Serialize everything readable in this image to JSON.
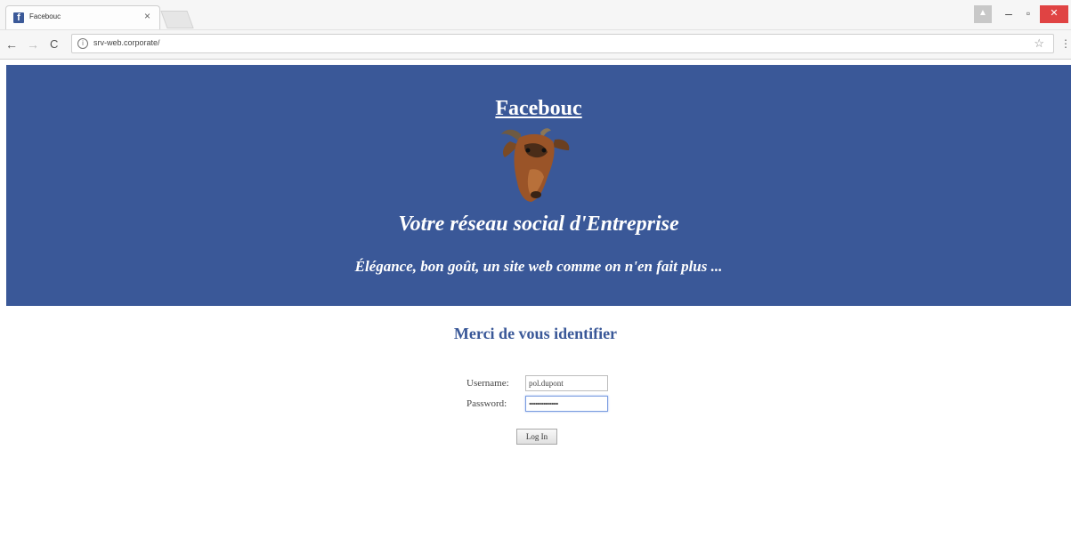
{
  "browser": {
    "tab_title": "Facebouc",
    "tab_close": "×",
    "favicon_letter": "f",
    "url": "srv-web.corporate/",
    "back": "←",
    "forward": "→",
    "reload": "C",
    "info": "i",
    "star": "☆",
    "menu": "⋮",
    "window": {
      "user": "▲",
      "minimize": "–",
      "maximize": "▫",
      "close": "✕"
    }
  },
  "banner": {
    "brand": "Facebouc",
    "tagline": "Votre réseau social d'Entreprise",
    "subtagline": "Élégance, bon goût, un site web comme on n'en fait plus ..."
  },
  "login": {
    "heading": "Merci de vous identifier",
    "username_label": "Username:",
    "username_value": "pol.dupont",
    "password_label": "Password:",
    "password_value": "••••••••••••••••••",
    "submit_label": "Log In"
  },
  "colors": {
    "banner_bg": "#3a5898",
    "heading": "#3a5898",
    "close_button": "#e04343"
  },
  "icons": [
    "facebook-favicon-icon",
    "close-icon",
    "back-icon",
    "forward-icon",
    "reload-icon",
    "info-icon",
    "star-icon",
    "menu-icon",
    "goat-image"
  ]
}
